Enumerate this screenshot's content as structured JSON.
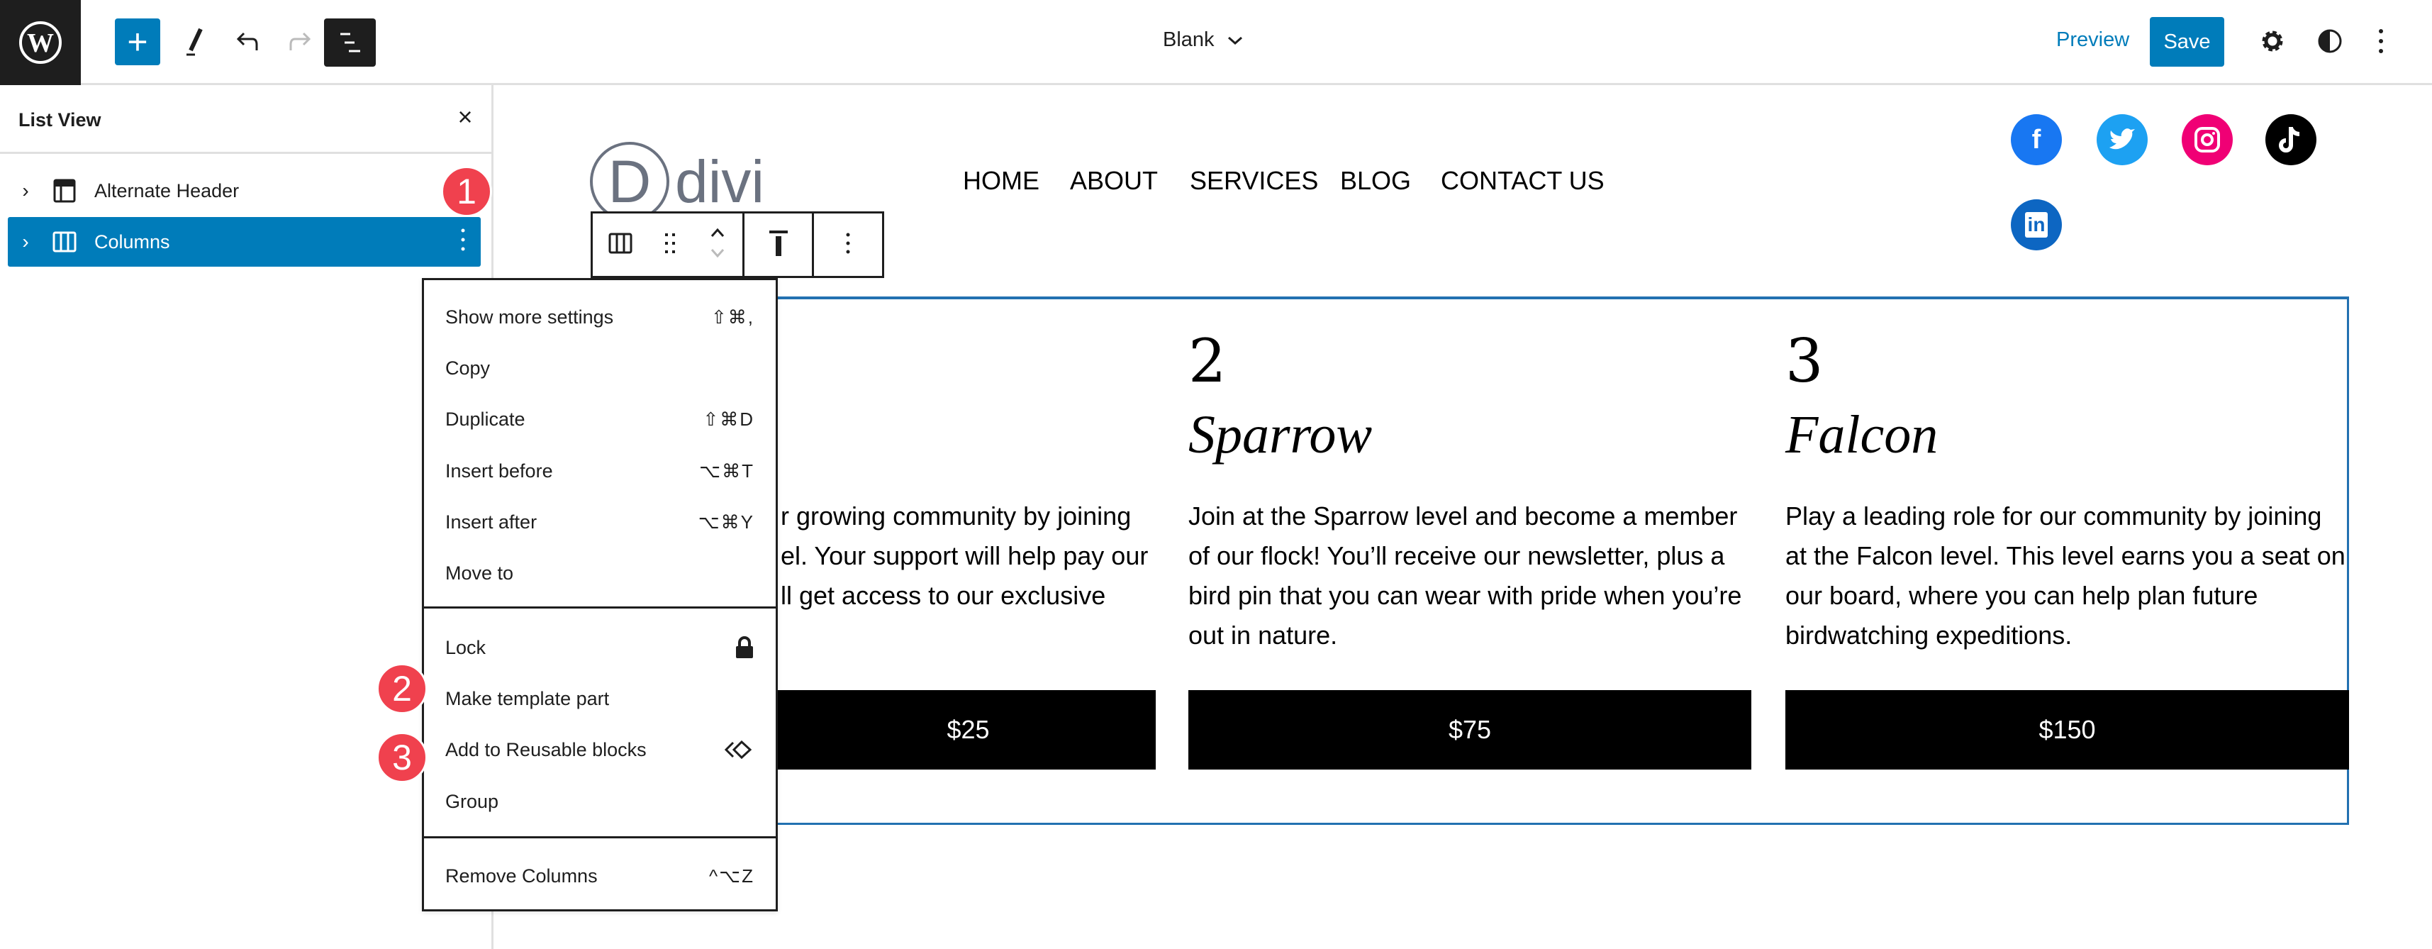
{
  "topbar": {
    "doc_title": "Blank",
    "preview_label": "Preview",
    "save_label": "Save",
    "accent": "#007cba"
  },
  "list_view": {
    "title": "List View",
    "items": [
      {
        "label": "Alternate Header",
        "icon": "template-part-icon",
        "selected": false
      },
      {
        "label": "Columns",
        "icon": "columns-icon",
        "selected": true
      }
    ]
  },
  "badges": [
    "1",
    "2",
    "3"
  ],
  "menu": {
    "group1": [
      {
        "label": "Show more settings",
        "shortcut": "⇧⌘,"
      },
      {
        "label": "Copy",
        "shortcut": ""
      },
      {
        "label": "Duplicate",
        "shortcut": "⇧⌘D"
      },
      {
        "label": "Insert before",
        "shortcut": "⌥⌘T"
      },
      {
        "label": "Insert after",
        "shortcut": "⌥⌘Y"
      },
      {
        "label": "Move to",
        "shortcut": ""
      }
    ],
    "group2": [
      {
        "label": "Lock",
        "icon": "lock-icon"
      },
      {
        "label": "Make template part"
      },
      {
        "label": "Add to Reusable blocks",
        "icon": "reusable-block-icon"
      },
      {
        "label": "Group"
      }
    ],
    "group3": [
      {
        "label": "Remove Columns",
        "shortcut": "^⌥Z"
      }
    ]
  },
  "site": {
    "logo_letter": "D",
    "logo_text": "divi",
    "nav": [
      "HOME",
      "ABOUT",
      "SERVICES",
      "BLOG",
      "CONTACT US"
    ],
    "social": [
      {
        "name": "facebook",
        "color": "#1877f2"
      },
      {
        "name": "twitter",
        "color": "#1da1f2"
      },
      {
        "name": "instagram",
        "color": "#f00075"
      },
      {
        "name": "tiktok",
        "color": "#000000"
      },
      {
        "name": "linkedin",
        "color": "#0d66c2"
      }
    ]
  },
  "columns": [
    {
      "lines": [
        "r growing community by joining",
        "el. Your support will help pay our",
        "ll get access to our exclusive"
      ],
      "price": "$25"
    },
    {
      "number": "2",
      "title": "Sparrow",
      "lines": [
        "Join at the Sparrow level and become a member",
        "of our flock! You’ll receive our newsletter, plus a",
        "bird pin that you can wear with pride when you’re",
        "out in nature."
      ],
      "price": "$75"
    },
    {
      "number": "3",
      "title": "Falcon",
      "lines": [
        "Play a leading role for our community by joining",
        "at the Falcon level. This level earns you a seat on",
        "our board, where you can help plan future",
        "birdwatching expeditions."
      ],
      "price": "$150"
    }
  ]
}
